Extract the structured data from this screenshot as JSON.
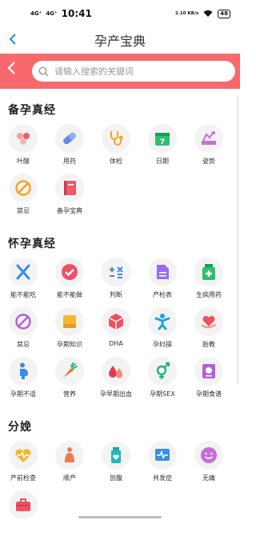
{
  "statusbar": {
    "signal1": "4G⁺",
    "signal2": "4G⁺",
    "time": "10:41",
    "speed": "2.10 KB/s",
    "battery": "48"
  },
  "header": {
    "title": "孕产宝典"
  },
  "search": {
    "placeholder": "请输入搜索的关键词"
  },
  "sections": [
    {
      "title": "备孕真经",
      "items": [
        {
          "label": "叶酸",
          "icon": "folic-acid-icon"
        },
        {
          "label": "用药",
          "icon": "pill-icon"
        },
        {
          "label": "体检",
          "icon": "stethoscope-icon"
        },
        {
          "label": "日期",
          "icon": "calendar-icon"
        },
        {
          "label": "姿势",
          "icon": "posture-icon"
        },
        {
          "label": "禁忌",
          "icon": "forbidden-icon"
        },
        {
          "label": "备孕宝典",
          "icon": "book-icon"
        }
      ]
    },
    {
      "title": "怀孕真经",
      "items": [
        {
          "label": "能不能吃",
          "icon": "fork-knife-icon"
        },
        {
          "label": "能不能做",
          "icon": "check-icon"
        },
        {
          "label": "判断",
          "icon": "judge-icon"
        },
        {
          "label": "产检表",
          "icon": "document-icon"
        },
        {
          "label": "生病用药",
          "icon": "medicine-bottle-icon"
        },
        {
          "label": "禁忌",
          "icon": "forbidden-icon"
        },
        {
          "label": "孕期知识",
          "icon": "knowledge-icon"
        },
        {
          "label": "DHA",
          "icon": "cube-icon"
        },
        {
          "label": "孕妇操",
          "icon": "exercise-icon"
        },
        {
          "label": "胎教",
          "icon": "heart-hand-icon"
        },
        {
          "label": "孕期不适",
          "icon": "pregnant-icon"
        },
        {
          "label": "营养",
          "icon": "carrot-icon"
        },
        {
          "label": "孕早期出血",
          "icon": "blood-drops-icon"
        },
        {
          "label": "孕期SEX",
          "icon": "gender-icon"
        },
        {
          "label": "孕期食谱",
          "icon": "recipe-icon"
        }
      ]
    },
    {
      "title": "分娩",
      "items": [
        {
          "label": "产前检查",
          "icon": "heart-pulse-icon"
        },
        {
          "label": "顺产",
          "icon": "birth-icon"
        },
        {
          "label": "剖腹",
          "icon": "bottle-heart-icon"
        },
        {
          "label": "并发症",
          "icon": "monitor-pulse-icon"
        },
        {
          "label": "无痛",
          "icon": "smile-icon"
        },
        {
          "label": "",
          "icon": "toolbox-icon"
        }
      ]
    }
  ]
}
